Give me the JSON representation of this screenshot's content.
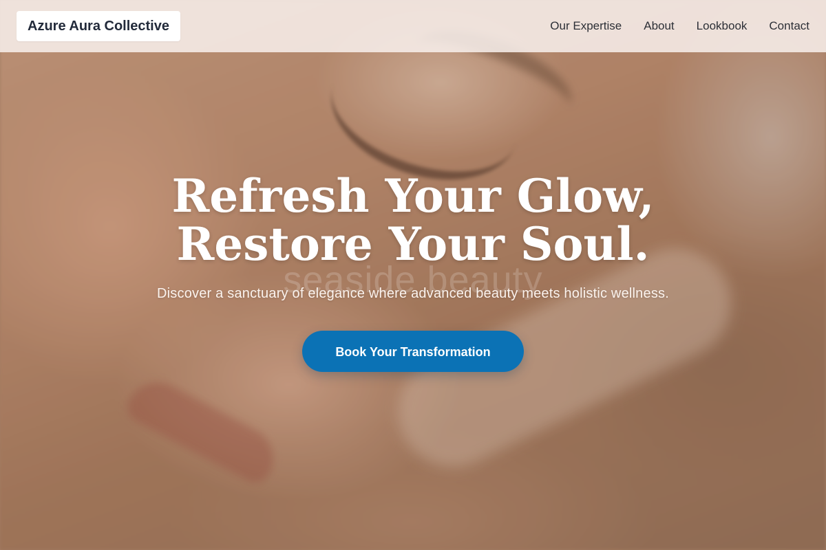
{
  "navbar": {
    "brand": "Azure Aura Collective",
    "links": [
      {
        "label": "Our Expertise"
      },
      {
        "label": "About"
      },
      {
        "label": "Lookbook"
      },
      {
        "label": "Contact"
      }
    ]
  },
  "hero": {
    "title_line_1": "Refresh Your Glow,",
    "title_line_2": "Restore Your Soul.",
    "subtitle": "Discover a sanctuary of elegance where advanced beauty meets holistic wellness.",
    "cta_label": "Book Your Transformation",
    "watermark": "seaside beauty"
  },
  "colors": {
    "accent": "#0b72b5",
    "nav_bg": "#f8f0ec",
    "text_dark": "#222a3a"
  }
}
